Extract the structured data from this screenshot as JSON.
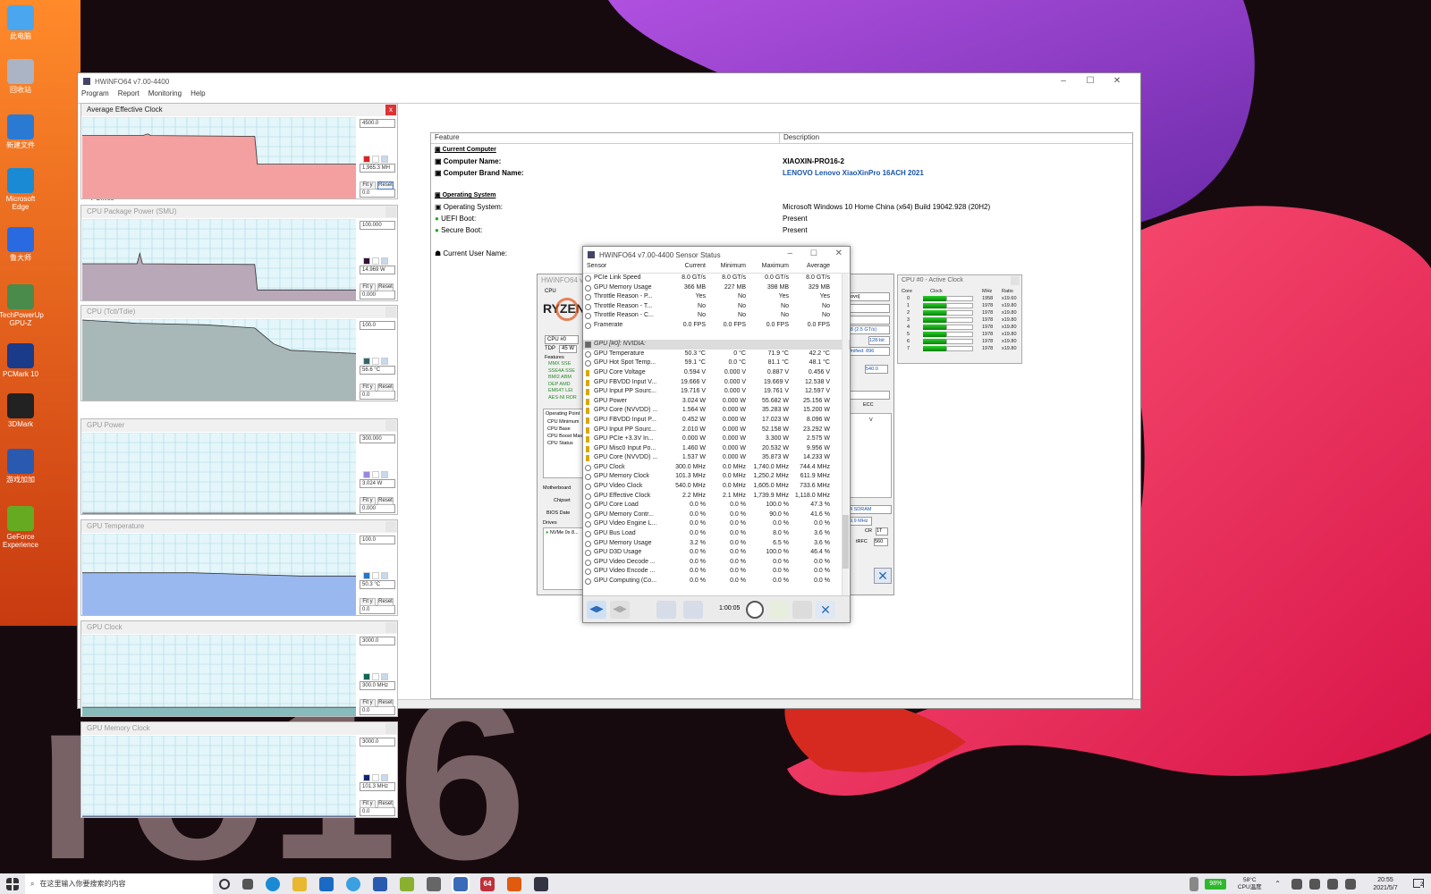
{
  "desktop": {
    "icons": [
      {
        "label": "此电脑"
      },
      {
        "label": "回收站"
      },
      {
        "label": "新建文件"
      },
      {
        "label": "Microsoft Edge"
      },
      {
        "label": "鲁大师"
      },
      {
        "label": "TechPowerUp GPU-Z"
      },
      {
        "label": "PCMark 10"
      },
      {
        "label": "3DMark"
      },
      {
        "label": "游戏加加"
      },
      {
        "label": "GeForce Experience"
      }
    ]
  },
  "main_window": {
    "title": "HWiNFO64 v7.00-4400",
    "menu": [
      "Program",
      "Report",
      "Monitoring",
      "Help"
    ],
    "tree_fragment": "Drives",
    "columns": {
      "feature": "Feature",
      "description": "Description"
    },
    "sections": {
      "computer": "Current Computer",
      "os": "Operating System"
    },
    "rows": [
      {
        "feature": "Computer Name:",
        "description": "XIAOXIN-PRO16-2"
      },
      {
        "feature": "Computer Brand Name:",
        "description": "LENOVO Lenovo XiaoXinPro 16ACH 2021"
      },
      {
        "feature": "Operating System:",
        "description": "Microsoft Windows 10 Home China (x64) Build 19042.928 (20H2)"
      },
      {
        "feature": "UEFI Boot:",
        "description": "Present"
      },
      {
        "feature": "Secure Boot:",
        "description": "Present"
      },
      {
        "feature": "Current User Name:",
        "description": ""
      }
    ]
  },
  "graphs": [
    {
      "title": "Average Effective Clock",
      "max": "4500.0",
      "current": "1,965.3 MH",
      "min": "0.0",
      "color": "#f4a0a0",
      "swatch": "#dd2222",
      "active": true
    },
    {
      "title": "CPU Package Power (SMU)",
      "max": "100.000",
      "current": "14.969 W",
      "min": "0.000",
      "color": "#b8a8b8",
      "swatch": "#331133",
      "active": false
    },
    {
      "title": "CPU (Tctl/Tdie)",
      "max": "100.0",
      "current": "56.6 °C",
      "min": "0.0",
      "color": "#a8b8b8",
      "swatch": "#336666",
      "active": false
    },
    {
      "title": "GPU Power",
      "max": "300.000",
      "current": "3.024 W",
      "min": "0.000",
      "color": "#b8b0ff",
      "swatch": "#9988dd",
      "active": false
    },
    {
      "title": "GPU Temperature",
      "max": "100.0",
      "current": "50.3 °C",
      "min": "0.0",
      "color": "#9ab8f0",
      "swatch": "#2277cc",
      "active": false
    },
    {
      "title": "GPU Clock",
      "max": "3000.0",
      "current": "300.0 MHz",
      "min": "0.0",
      "color": "#88bbbb",
      "swatch": "#116655",
      "active": false
    },
    {
      "title": "GPU Memory Clock",
      "max": "3000.0",
      "current": "101.3 MHz",
      "min": "0.0",
      "color": "#8899cc",
      "swatch": "#112277",
      "active": false
    }
  ],
  "graph_buttons": {
    "fit": "Fit y",
    "reset": "Reset"
  },
  "sensor_window": {
    "title": "HWiNFO64 v7.00-4400 Sensor Status",
    "headers": [
      "Sensor",
      "Current",
      "Minimum",
      "Maximum",
      "Average"
    ],
    "rows": [
      {
        "name": "PCIe Link Speed",
        "cur": "8.0 GT/s",
        "min": "8.0 GT/s",
        "max": "0.0 GT/s",
        "avg": "8.0 GT/s",
        "icon": "circle"
      },
      {
        "name": "GPU Memory Usage",
        "cur": "366 MB",
        "min": "227 MB",
        "max": "398 MB",
        "avg": "329 MB",
        "icon": "circle"
      },
      {
        "name": "Throttle Reason - P...",
        "cur": "Yes",
        "min": "No",
        "max": "Yes",
        "avg": "Yes",
        "icon": "circle"
      },
      {
        "name": "Throttle Reason - T...",
        "cur": "No",
        "min": "No",
        "max": "No",
        "avg": "No",
        "icon": "circle"
      },
      {
        "name": "Throttle Reason - C...",
        "cur": "No",
        "min": "No",
        "max": "No",
        "avg": "No",
        "icon": "circle"
      },
      {
        "name": "Framerate",
        "cur": "0.0 FPS",
        "min": "0.0 FPS",
        "max": "0.0 FPS",
        "avg": "0.0 FPS",
        "icon": "circle"
      },
      {
        "name": "",
        "cur": "",
        "min": "",
        "max": "",
        "avg": "",
        "icon": "none"
      },
      {
        "name": "GPU [#0]: NVIDIA:",
        "cur": "",
        "min": "",
        "max": "",
        "avg": "",
        "icon": "section"
      },
      {
        "name": "GPU Temperature",
        "cur": "50.3 °C",
        "min": "0 °C",
        "max": "71.9 °C",
        "avg": "42.2 °C",
        "icon": "circle"
      },
      {
        "name": "GPU Hot Spot Temp...",
        "cur": "59.1 °C",
        "min": "0.0 °C",
        "max": "81.1 °C",
        "avg": "48.1 °C",
        "icon": "circle"
      },
      {
        "name": "GPU Core Voltage",
        "cur": "0.594 V",
        "min": "0.000 V",
        "max": "0.887 V",
        "avg": "0.456 V",
        "icon": "bolt"
      },
      {
        "name": "GPU FBVDD Input V...",
        "cur": "19.666 V",
        "min": "0.000 V",
        "max": "19.669 V",
        "avg": "12.538 V",
        "icon": "bolt"
      },
      {
        "name": "GPU Input PP Sourc...",
        "cur": "19.716 V",
        "min": "0.000 V",
        "max": "19.761 V",
        "avg": "12.597 V",
        "icon": "bolt"
      },
      {
        "name": "GPU Power",
        "cur": "3.024 W",
        "min": "0.000 W",
        "max": "55.682 W",
        "avg": "25.156 W",
        "icon": "bolt"
      },
      {
        "name": "GPU Core (NVVDD) ...",
        "cur": "1.564 W",
        "min": "0.000 W",
        "max": "35.283 W",
        "avg": "15.200 W",
        "icon": "bolt"
      },
      {
        "name": "GPU FBVDD Input P...",
        "cur": "0.452 W",
        "min": "0.000 W",
        "max": "17.023 W",
        "avg": "8.096 W",
        "icon": "bolt"
      },
      {
        "name": "GPU Input PP Sourc...",
        "cur": "2.010 W",
        "min": "0.000 W",
        "max": "52.158 W",
        "avg": "23.292 W",
        "icon": "bolt"
      },
      {
        "name": "GPU PCIe +3.3V In...",
        "cur": "0.000 W",
        "min": "0.000 W",
        "max": "3.300 W",
        "avg": "2.575 W",
        "icon": "bolt"
      },
      {
        "name": "GPU Misc0 Input Po...",
        "cur": "1.460 W",
        "min": "0.000 W",
        "max": "20.532 W",
        "avg": "9.956 W",
        "icon": "bolt"
      },
      {
        "name": "GPU Core (NVVDD) ...",
        "cur": "1.537 W",
        "min": "0.000 W",
        "max": "35.873 W",
        "avg": "14.233 W",
        "icon": "bolt"
      },
      {
        "name": "GPU Clock",
        "cur": "300.0 MHz",
        "min": "0.0 MHz",
        "max": "1,740.0 MHz",
        "avg": "744.4 MHz",
        "icon": "circle"
      },
      {
        "name": "GPU Memory Clock",
        "cur": "101.3 MHz",
        "min": "0.0 MHz",
        "max": "1,250.2 MHz",
        "avg": "611.9 MHz",
        "icon": "circle"
      },
      {
        "name": "GPU Video Clock",
        "cur": "540.0 MHz",
        "min": "0.0 MHz",
        "max": "1,605.0 MHz",
        "avg": "733.6 MHz",
        "icon": "circle"
      },
      {
        "name": "GPU Effective Clock",
        "cur": "2.2 MHz",
        "min": "2.1 MHz",
        "max": "1,739.9 MHz",
        "avg": "1,118.0 MHz",
        "icon": "circle"
      },
      {
        "name": "GPU Core Load",
        "cur": "0.0 %",
        "min": "0.0 %",
        "max": "100.0 %",
        "avg": "47.3 %",
        "icon": "circle"
      },
      {
        "name": "GPU Memory Contr...",
        "cur": "0.0 %",
        "min": "0.0 %",
        "max": "90.0 %",
        "avg": "41.6 %",
        "icon": "circle"
      },
      {
        "name": "GPU Video Engine L...",
        "cur": "0.0 %",
        "min": "0.0 %",
        "max": "0.0 %",
        "avg": "0.0 %",
        "icon": "circle"
      },
      {
        "name": "GPU Bus Load",
        "cur": "0.0 %",
        "min": "0.0 %",
        "max": "8.0 %",
        "avg": "3.6 %",
        "icon": "circle"
      },
      {
        "name": "GPU Memory Usage",
        "cur": "3.2 %",
        "min": "0.0 %",
        "max": "6.5 %",
        "avg": "3.6 %",
        "icon": "circle"
      },
      {
        "name": "GPU D3D Usage",
        "cur": "0.0 %",
        "min": "0.0 %",
        "max": "100.0 %",
        "avg": "46.4 %",
        "icon": "circle"
      },
      {
        "name": "GPU Video Decode ...",
        "cur": "0.0 %",
        "min": "0.0 %",
        "max": "0.0 %",
        "avg": "0.0 %",
        "icon": "circle"
      },
      {
        "name": "GPU Video Encode ...",
        "cur": "0.0 %",
        "min": "0.0 %",
        "max": "0.0 %",
        "avg": "0.0 %",
        "icon": "circle"
      },
      {
        "name": "GPU Computing (Co...",
        "cur": "0.0 %",
        "min": "0.0 %",
        "max": "0.0 %",
        "avg": "0.0 %",
        "icon": "circle"
      }
    ],
    "timer": "1:00:05"
  },
  "cpu_window": {
    "title": "HWiNFO64 v",
    "labels": [
      "CPU",
      "RYZEN",
      "CPU #0",
      "TDP",
      "45 W",
      "Features",
      "Operating Point",
      "CPU Minimum",
      "CPU Base",
      "CPU Boost Max",
      "CPU Status",
      "Motherboard",
      "Chipset",
      "BIOS Date",
      "Drives",
      "NVMe 0x 8..."
    ],
    "right_labels": [
      "novo]",
      "x8 (2.5 GT/s)",
      "128-bit",
      "Unified: 896",
      "540.0",
      "ECC",
      "V",
      "4 SDRAM",
      "9.9 MHz",
      "CR",
      "1T",
      "tRFC",
      "560"
    ]
  },
  "clock_window": {
    "title": "CPU #0 - Active Clock",
    "headers": [
      "Core",
      "Clock",
      "MHz",
      "Ratio"
    ],
    "rows": [
      {
        "core": "0",
        "mhz": "1958",
        "ratio": "x19.60"
      },
      {
        "core": "1",
        "mhz": "1978",
        "ratio": "x19.80"
      },
      {
        "core": "2",
        "mhz": "1978",
        "ratio": "x19.80"
      },
      {
        "core": "3",
        "mhz": "1978",
        "ratio": "x19.80"
      },
      {
        "core": "4",
        "mhz": "1978",
        "ratio": "x19.80"
      },
      {
        "core": "5",
        "mhz": "1978",
        "ratio": "x19.80"
      },
      {
        "core": "6",
        "mhz": "1978",
        "ratio": "x19.80"
      },
      {
        "core": "7",
        "mhz": "1978",
        "ratio": "x19.80"
      }
    ]
  },
  "taskbar": {
    "search_placeholder": "在这里输入你要搜索的内容",
    "battery": "98%",
    "cpu_temp": "58°C",
    "cpu_temp_label": "CPU温度",
    "time": "20:55",
    "date": "2021/5/7",
    "notification_count": "2"
  }
}
